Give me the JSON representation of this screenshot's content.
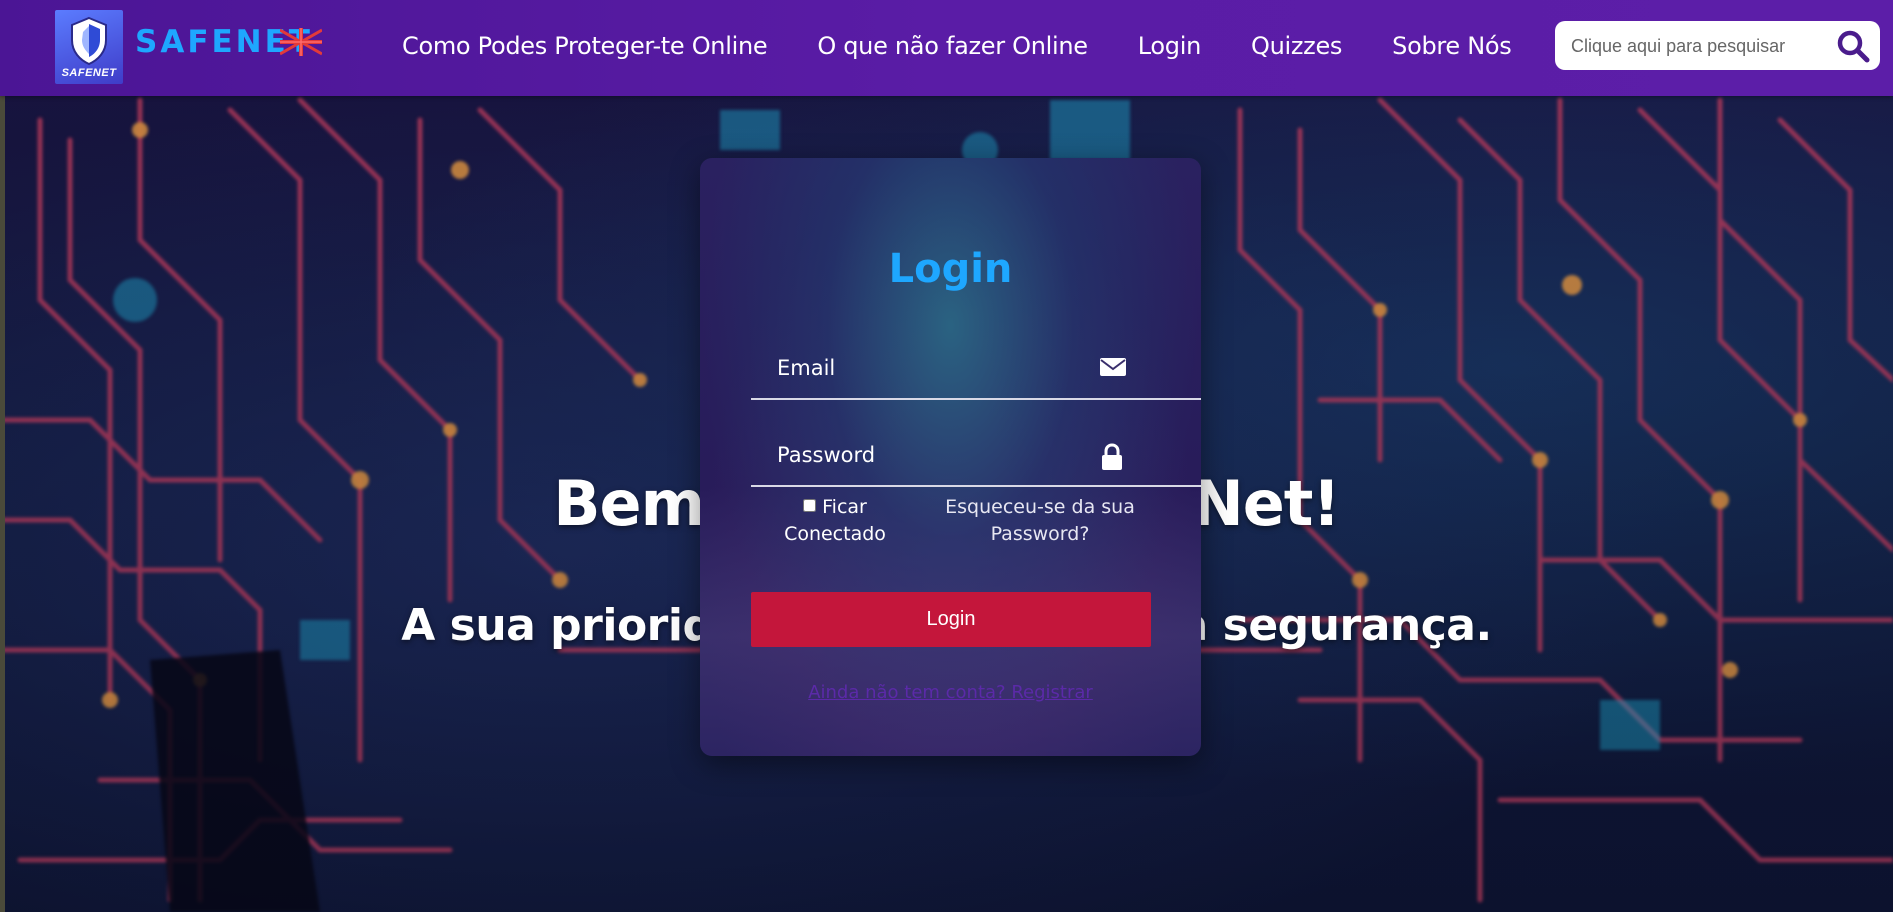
{
  "header": {
    "brand": "SAFENET",
    "logo_caption": "SAFENET",
    "nav": [
      {
        "label": "Como Podes Proteger-te Online"
      },
      {
        "label": "O que não fazer Online"
      },
      {
        "label": "Login"
      },
      {
        "label": "Quizzes"
      },
      {
        "label": "Sobre Nós"
      }
    ],
    "search": {
      "placeholder": "Clique aqui para pesquisar",
      "icon": "search-icon"
    }
  },
  "hero": {
    "title": "Bem-vindo ao SafeNet!",
    "subtitle": "A sua prioridade é a nossa, a sua segurança."
  },
  "login": {
    "title": "Login",
    "email_placeholder": "Email",
    "email_icon": "envelope-icon",
    "password_placeholder": "Password",
    "password_icon": "lock-icon",
    "remember_label": "Ficar Conectado",
    "forgot_label": "Esqueceu-se da sua Password?",
    "button_label": "Login",
    "register_label": "Ainda não tem conta? Registrar"
  },
  "colors": {
    "header": "#5a1ca6",
    "accent_blue": "#1ea7ff",
    "login_button": "#c4163b"
  }
}
